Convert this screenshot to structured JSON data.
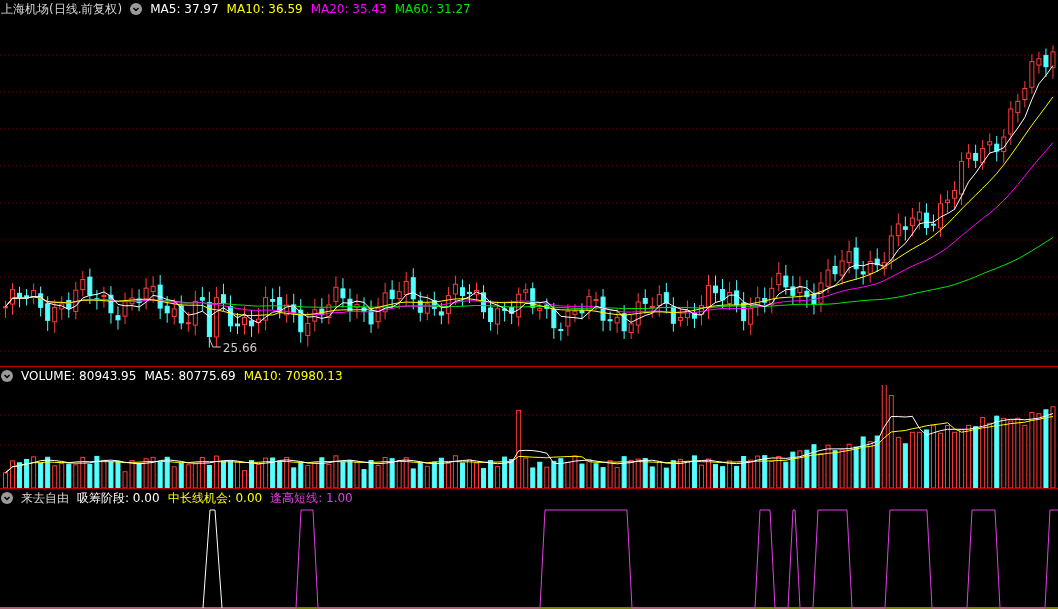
{
  "price_panel": {
    "title": "上海机场(日线.前复权)",
    "indicators": [
      {
        "text": "MA5: 37.97",
        "color": "#ffffff"
      },
      {
        "text": "MA10: 36.59",
        "color": "#ffff00"
      },
      {
        "text": "MA20: 35.43",
        "color": "#ff00ff"
      },
      {
        "text": "MA60: 31.27",
        "color": "#00e600"
      }
    ],
    "low_label": "25.66"
  },
  "volume_panel": {
    "indicators": [
      {
        "text": "VOLUME: 80943.95",
        "color": "#ffffff"
      },
      {
        "text": "MA5: 80775.69",
        "color": "#ffffff"
      },
      {
        "text": "MA10: 70980.13",
        "color": "#ffff00"
      }
    ]
  },
  "signal_panel": {
    "title": "来去自由",
    "indicators": [
      {
        "text": "吸筹阶段: 0.00",
        "color": "#ffffff"
      },
      {
        "text": "中长线机会: 0.00",
        "color": "#ffff00"
      },
      {
        "text": "逢高短线: 1.00",
        "color": "#e040e0"
      }
    ]
  }
}
